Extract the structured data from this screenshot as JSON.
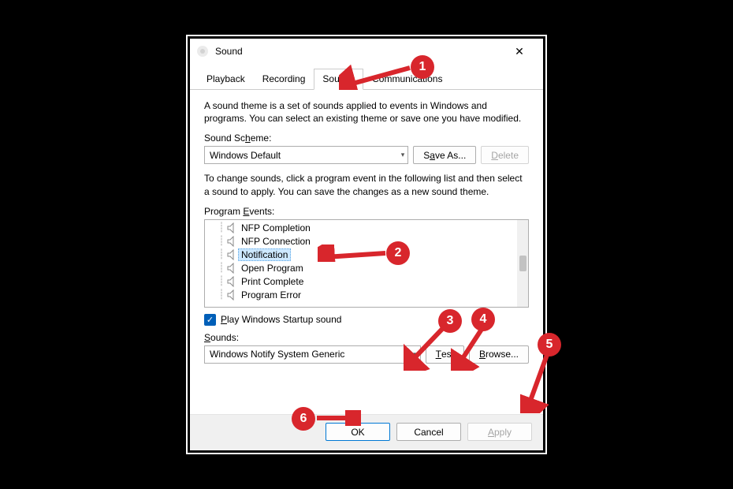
{
  "dialog": {
    "title": "Sound",
    "close_glyph": "✕"
  },
  "tabs": [
    "Playback",
    "Recording",
    "Sounds",
    "Communications"
  ],
  "activeTabIndex": 2,
  "desc1": "A sound theme is a set of sounds applied to events in Windows and programs. You can select an existing theme or save one you have modified.",
  "schemeLabel": "Sound Scheme:",
  "schemeValue": "Windows Default",
  "saveAsLabel": "Save As...",
  "deleteLabel": "Delete",
  "desc2": "To change sounds, click a program event in the following list and then select a sound to apply. You can save the changes as a new sound theme.",
  "eventsLabel": "Program Events:",
  "events": [
    "NFP Completion",
    "NFP Connection",
    "Notification",
    "Open Program",
    "Print Complete",
    "Program Error"
  ],
  "selectedEventIndex": 2,
  "startupCheck": "Play Windows Startup sound",
  "soundsLabel": "Sounds:",
  "soundsValue": "Windows Notify System Generic",
  "testLabel": "Test",
  "browseLabel": "Browse...",
  "buttons": {
    "ok": "OK",
    "cancel": "Cancel",
    "apply": "Apply"
  },
  "annotations": [
    "1",
    "2",
    "3",
    "4",
    "5",
    "6"
  ]
}
